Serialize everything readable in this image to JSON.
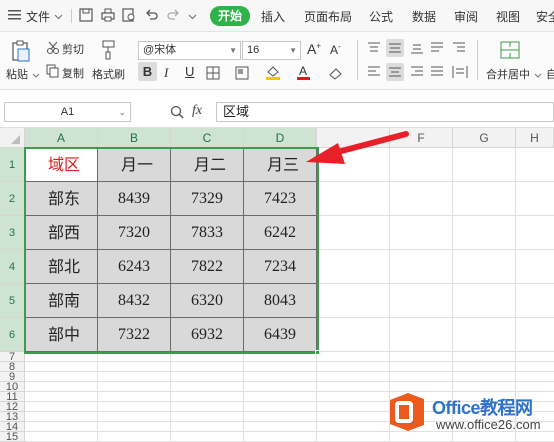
{
  "menu": {
    "file_label": "文件",
    "tabs": [
      "开始",
      "插入",
      "页面布局",
      "公式",
      "数据",
      "审阅",
      "视图",
      "安全"
    ],
    "active_tab": "开始"
  },
  "ribbon": {
    "cut": "剪切",
    "copy": "复制",
    "paste": "粘贴",
    "format_painter": "格式刷",
    "font_name": "@宋体",
    "font_size": "16",
    "bold": "B",
    "italic": "I",
    "underline": "U",
    "merge_center": "合并居中",
    "auto_wrap": "自"
  },
  "formula_bar": {
    "name_box": "A1",
    "fx_label": "fx",
    "content": "区域"
  },
  "grid": {
    "columns": [
      "A",
      "B",
      "C",
      "D",
      "F",
      "G",
      "H"
    ],
    "rows": [
      "1",
      "2",
      "3",
      "4",
      "5",
      "6",
      "7",
      "8",
      "9",
      "10",
      "11",
      "12",
      "13",
      "14",
      "15"
    ],
    "header": [
      "区域",
      "一月",
      "二月",
      "三月"
    ],
    "data": [
      {
        "region": "东部",
        "values": [
          "8439",
          "7329",
          "7423"
        ]
      },
      {
        "region": "西部",
        "values": [
          "7320",
          "7833",
          "6242"
        ]
      },
      {
        "region": "北部",
        "values": [
          "6243",
          "7822",
          "7234"
        ]
      },
      {
        "region": "南部",
        "values": [
          "8432",
          "6320",
          "8043"
        ]
      },
      {
        "region": "中部",
        "values": [
          "7322",
          "6932",
          "6439"
        ]
      }
    ]
  },
  "watermark": {
    "line1": "Office教程网",
    "line2": "www.office26.com"
  },
  "colors": {
    "accent": "#2fb24a",
    "selection": "#3f9a4f",
    "arrow": "#e8202a",
    "header_red": "#e01b1b"
  }
}
